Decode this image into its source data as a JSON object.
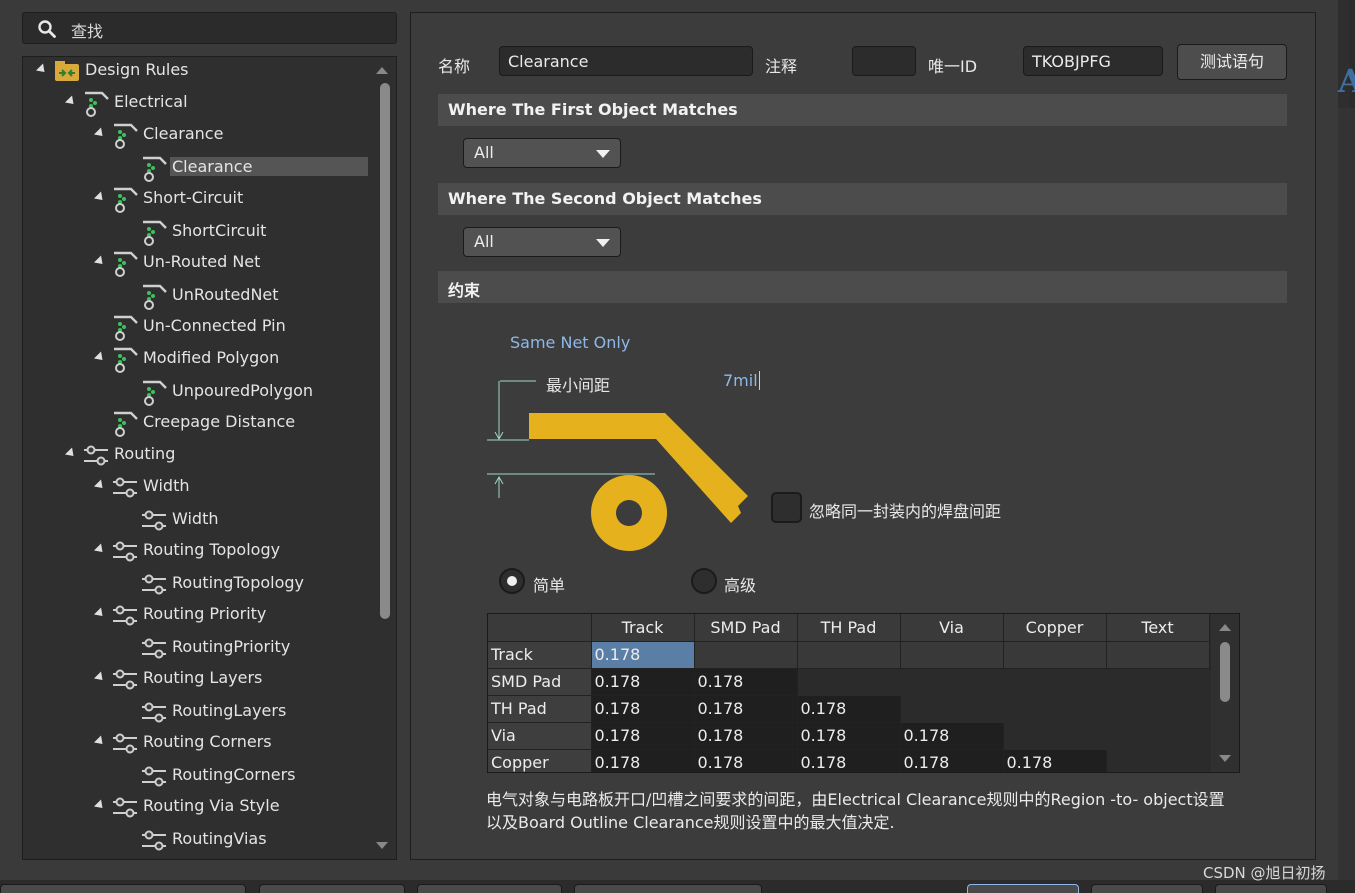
{
  "search": {
    "placeholder": "查找"
  },
  "tree": [
    {
      "label": "Design Rules"
    },
    {
      "label": "Electrical"
    },
    {
      "label": "Clearance"
    },
    {
      "label": "Clearance"
    },
    {
      "label": "Short-Circuit"
    },
    {
      "label": "ShortCircuit"
    },
    {
      "label": "Un-Routed Net"
    },
    {
      "label": "UnRoutedNet"
    },
    {
      "label": "Un-Connected Pin"
    },
    {
      "label": "Modified Polygon"
    },
    {
      "label": "UnpouredPolygon"
    },
    {
      "label": "Creepage Distance"
    },
    {
      "label": "Routing"
    },
    {
      "label": "Width"
    },
    {
      "label": "Width"
    },
    {
      "label": "Routing Topology"
    },
    {
      "label": "RoutingTopology"
    },
    {
      "label": "Routing Priority"
    },
    {
      "label": "RoutingPriority"
    },
    {
      "label": "Routing Layers"
    },
    {
      "label": "RoutingLayers"
    },
    {
      "label": "Routing Corners"
    },
    {
      "label": "RoutingCorners"
    },
    {
      "label": "Routing Via Style"
    },
    {
      "label": "RoutingVias"
    }
  ],
  "rule": {
    "name_label": "名称",
    "name_value": "Clearance",
    "comment_label": "注释",
    "comment_value": "",
    "uid_label": "唯一ID",
    "uid_value": "TKOBJPFG",
    "test_button": "测试语句"
  },
  "first_match": {
    "title": "Where The First Object Matches",
    "value": "All"
  },
  "second_match": {
    "title": "Where The Second Object Matches",
    "value": "All"
  },
  "constraints": {
    "title": "约束",
    "same_net_only": "Same Net Only",
    "min_clearance_label": "最小间距",
    "min_clearance_value": "7mil",
    "ignore_pad_label": "忽略同一封装内的焊盘间距",
    "mode_simple": "简单",
    "mode_advanced": "高级",
    "selected_mode": "简单",
    "colors": {
      "trace": "#e5b21e",
      "accent_text": "#8fb8e8"
    }
  },
  "matrix": {
    "columns": [
      "Track",
      "SMD Pad",
      "TH Pad",
      "Via",
      "Copper",
      "Text"
    ],
    "rows": [
      {
        "name": "Track",
        "values": [
          "0.178"
        ]
      },
      {
        "name": "SMD Pad",
        "values": [
          "0.178",
          "0.178"
        ]
      },
      {
        "name": "TH Pad",
        "values": [
          "0.178",
          "0.178",
          "0.178"
        ]
      },
      {
        "name": "Via",
        "values": [
          "0.178",
          "0.178",
          "0.178",
          "0.178"
        ]
      },
      {
        "name": "Copper",
        "values": [
          "0.178",
          "0.178",
          "0.178",
          "0.178",
          "0.178"
        ]
      }
    ]
  },
  "description": {
    "line1": "电气对象与电路板开口/凹槽之间要求的间距，由Electrical Clearance规则中的Region -to- object设置",
    "line2": "以及Board Outline Clearance规则设置中的最大值决定."
  },
  "watermark": "CSDN @旭日初扬",
  "edge_glyph": "A"
}
